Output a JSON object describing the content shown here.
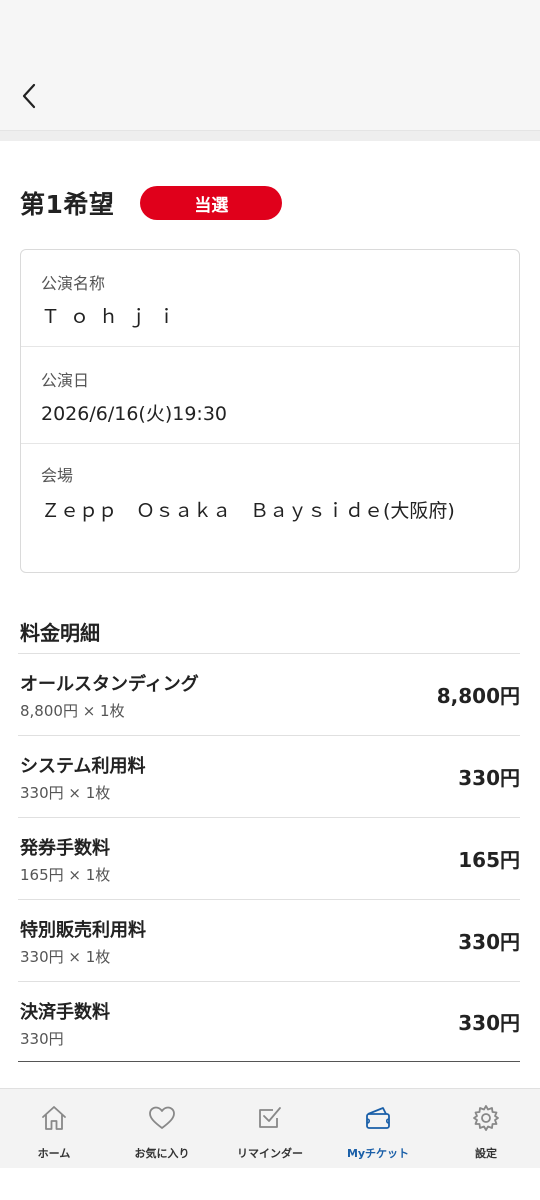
{
  "header": {
    "back_icon": "chevron-left-icon"
  },
  "choice": {
    "title": "第1希望",
    "status": "当選",
    "status_color": "#e0001b"
  },
  "performance": {
    "name_label": "公演名称",
    "name_value": "Ｔｏｈｊｉ",
    "date_label": "公演日",
    "date_value": "2026/6/16(火)19:30",
    "venue_label": "会場",
    "venue_value": "Ｚｅｐｐ　Ｏｓａｋａ　Ｂａｙｓｉｄｅ(大阪府)"
  },
  "fees": {
    "title": "料金明細",
    "items": [
      {
        "name": "オールスタンディング",
        "detail": "8,800円 × 1枚",
        "price": "8,800円"
      },
      {
        "name": "システム利用料",
        "detail": "330円 × 1枚",
        "price": "330円"
      },
      {
        "name": "発券手数料",
        "detail": "165円 × 1枚",
        "price": "165円"
      },
      {
        "name": "特別販売利用料",
        "detail": "330円 × 1枚",
        "price": "330円"
      },
      {
        "name": "決済手数料",
        "detail": "330円",
        "price": "330円"
      }
    ]
  },
  "nav": {
    "active_color": "#1a5fa8",
    "items": [
      {
        "label": "ホーム",
        "icon": "home-icon"
      },
      {
        "label": "お気に入り",
        "icon": "heart-icon"
      },
      {
        "label": "リマインダー",
        "icon": "checkbox-icon"
      },
      {
        "label": "Myチケット",
        "icon": "ticket-icon"
      },
      {
        "label": "設定",
        "icon": "gear-icon"
      }
    ]
  }
}
